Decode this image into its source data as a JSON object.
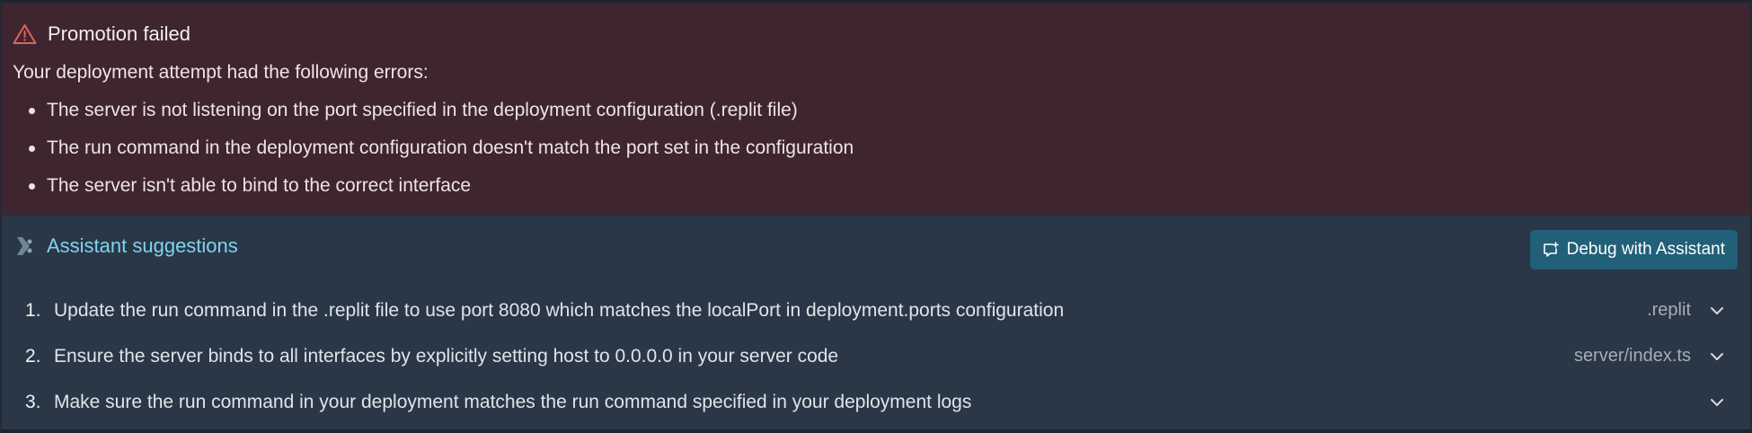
{
  "error": {
    "title": "Promotion failed",
    "intro": "Your deployment attempt had the following errors:",
    "items": [
      "The server is not listening on the port specified in the deployment configuration (.replit file)",
      "The run command in the deployment configuration doesn't match the port set in the configuration",
      "The server isn't able to bind to the correct interface"
    ],
    "icon": "warning-triangle-icon",
    "accent_color": "#e0625e",
    "background_color": "#3e2530"
  },
  "suggestions": {
    "title": "Assistant suggestions",
    "icon": "assistant-icon",
    "title_color": "#7fd3f0",
    "debug_button_label": "Debug with Assistant",
    "debug_button_color": "#216078",
    "items": [
      {
        "number": "1.",
        "text": "Update the run command in the .replit file to use port 8080 which matches the localPort in deployment.ports configuration",
        "file": ".replit"
      },
      {
        "number": "2.",
        "text": "Ensure the server binds to all interfaces by explicitly setting host to 0.0.0.0 in your server code",
        "file": "server/index.ts"
      },
      {
        "number": "3.",
        "text": "Make sure the run command in your deployment matches the run command specified in your deployment logs",
        "file": ""
      }
    ]
  }
}
